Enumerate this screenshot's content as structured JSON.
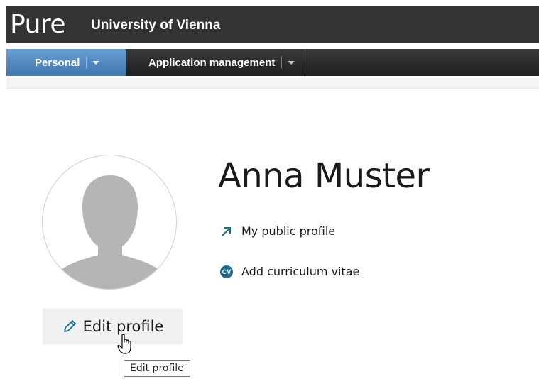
{
  "header": {
    "logo": "Pure",
    "organization": "University of Vienna"
  },
  "nav": {
    "tabs": [
      {
        "label": "Personal",
        "active": true
      },
      {
        "label": "Application management",
        "active": false
      }
    ]
  },
  "profile": {
    "name": "Anna Muster",
    "links": {
      "public_profile": "My public profile",
      "add_cv": "Add curriculum vitae",
      "cv_icon_text": "CV"
    },
    "edit_button": "Edit profile",
    "tooltip": "Edit profile"
  },
  "colors": {
    "header_bg": "#333333",
    "active_tab": "#4f86c0",
    "accent": "#1f6b8e"
  }
}
